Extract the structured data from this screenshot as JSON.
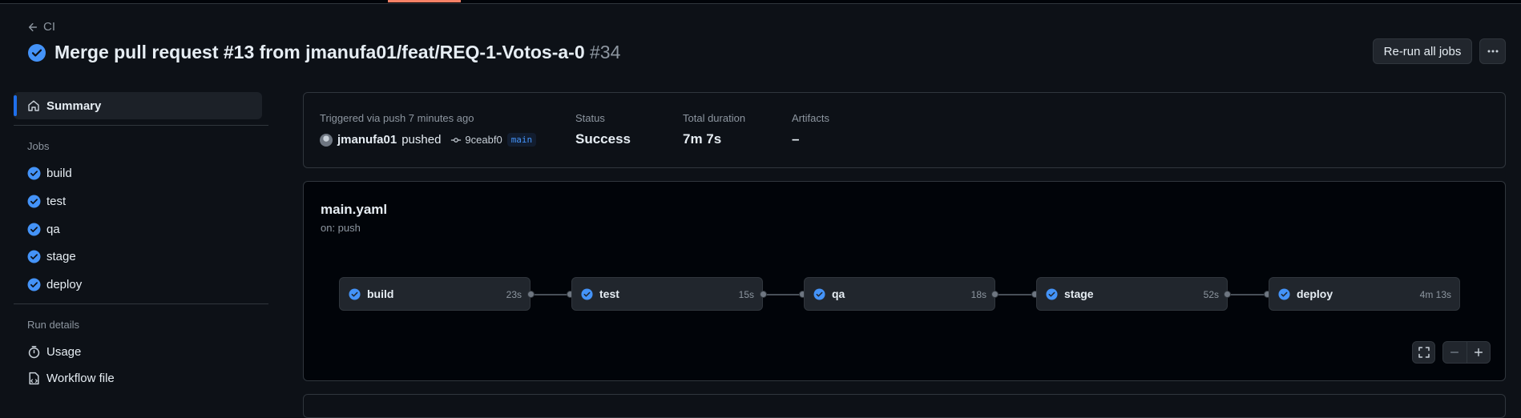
{
  "colors": {
    "success": "#4493f8",
    "accent_bar": "#1f6feb",
    "tab_highlight": "#f78166"
  },
  "back_link": {
    "label": "CI",
    "icon": "arrow-left-icon"
  },
  "header": {
    "title": "Merge pull request #13 from jmanufa01/feat/REQ-1-Votos-a-0",
    "run_number": "#34",
    "status_icon": "check-circle-fill-icon",
    "rerun_label": "Re-run all jobs",
    "more_icon": "kebab-horizontal-icon"
  },
  "sidebar": {
    "summary_label": "Summary",
    "jobs_heading": "Jobs",
    "jobs": [
      {
        "label": "build"
      },
      {
        "label": "test"
      },
      {
        "label": "qa"
      },
      {
        "label": "stage"
      },
      {
        "label": "deploy"
      }
    ],
    "run_details_heading": "Run details",
    "run_details": [
      {
        "label": "Usage",
        "icon": "stopwatch-icon"
      },
      {
        "label": "Workflow file",
        "icon": "file-icon"
      }
    ]
  },
  "summary": {
    "trigger_label": "Triggered via push 7 minutes ago",
    "user": "jmanufa01",
    "action": "pushed",
    "commit": "9ceabf0",
    "branch": "main",
    "status_label": "Status",
    "status_value": "Success",
    "duration_label": "Total duration",
    "duration_value": "7m 7s",
    "artifacts_label": "Artifacts",
    "artifacts_value": "–"
  },
  "workflow": {
    "file": "main.yaml",
    "trigger": "on: push",
    "jobs": [
      {
        "name": "build",
        "duration": "23s"
      },
      {
        "name": "test",
        "duration": "15s"
      },
      {
        "name": "qa",
        "duration": "18s"
      },
      {
        "name": "stage",
        "duration": "52s"
      },
      {
        "name": "deploy",
        "duration": "4m 13s"
      }
    ]
  }
}
